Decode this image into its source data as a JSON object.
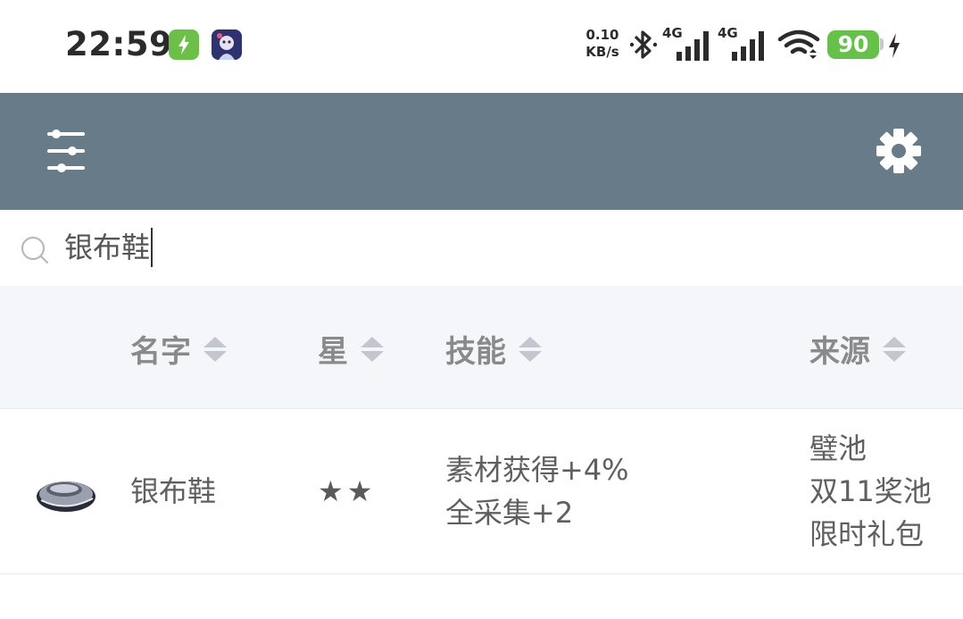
{
  "status_bar": {
    "time": "22:59",
    "net_speed_value": "0.10",
    "net_speed_unit": "KB/s",
    "network_1": "4G",
    "network_2": "4G",
    "battery_level": "90",
    "icons": [
      "bolt-app-icon",
      "game-app-icon",
      "bluetooth-icon",
      "signal-icon",
      "signal-icon",
      "wifi-icon",
      "battery-icon",
      "charging-icon"
    ]
  },
  "app_bar": {
    "color": "#677b88",
    "left_icon": "filter-sliders-icon",
    "right_icon": "gear-icon"
  },
  "search": {
    "icon": "search-icon",
    "value": "银布鞋"
  },
  "table": {
    "columns": [
      {
        "label": "名字",
        "sortable": true
      },
      {
        "label": "星",
        "sortable": true
      },
      {
        "label": "技能",
        "sortable": true
      },
      {
        "label": "来源",
        "sortable": true
      }
    ],
    "rows": [
      {
        "icon": "silver-shoe-icon",
        "name": "银布鞋",
        "stars": "★★",
        "skills": [
          "素材获得+4%",
          "全采集+2"
        ],
        "sources": [
          "璧池",
          "双11奖池",
          "限时礼包"
        ]
      }
    ]
  }
}
